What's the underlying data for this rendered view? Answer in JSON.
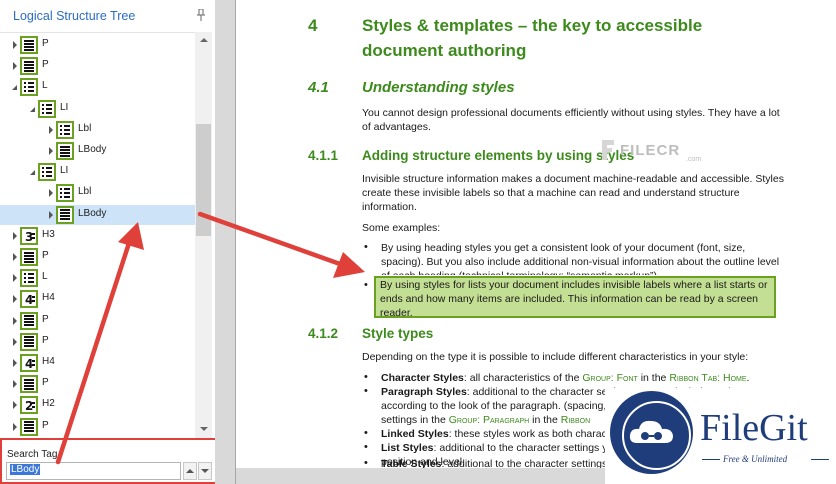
{
  "panel": {
    "title": "Logical Structure Tree",
    "tree": [
      {
        "tag": "P",
        "icon": "paragraph",
        "depth": 0,
        "expander": "collapsed"
      },
      {
        "tag": "P",
        "icon": "paragraph",
        "depth": 0,
        "expander": "collapsed"
      },
      {
        "tag": "L",
        "icon": "list",
        "depth": 0,
        "expander": "expanded"
      },
      {
        "tag": "LI",
        "icon": "list",
        "depth": 1,
        "expander": "expanded"
      },
      {
        "tag": "Lbl",
        "icon": "list",
        "depth": 2,
        "expander": "collapsed"
      },
      {
        "tag": "LBody",
        "icon": "paragraph",
        "depth": 2,
        "expander": "collapsed"
      },
      {
        "tag": "LI",
        "icon": "list",
        "depth": 1,
        "expander": "expanded"
      },
      {
        "tag": "Lbl",
        "icon": "list",
        "depth": 2,
        "expander": "collapsed"
      },
      {
        "tag": "LBody",
        "icon": "paragraph",
        "depth": 2,
        "expander": "collapsed",
        "selected": true
      },
      {
        "tag": "H3",
        "icon": "heading-3",
        "depth": 0,
        "expander": "collapsed"
      },
      {
        "tag": "P",
        "icon": "paragraph",
        "depth": 0,
        "expander": "collapsed"
      },
      {
        "tag": "L",
        "icon": "list",
        "depth": 0,
        "expander": "collapsed"
      },
      {
        "tag": "H4",
        "icon": "heading-4",
        "depth": 0,
        "expander": "collapsed"
      },
      {
        "tag": "P",
        "icon": "paragraph",
        "depth": 0,
        "expander": "collapsed"
      },
      {
        "tag": "P",
        "icon": "paragraph",
        "depth": 0,
        "expander": "collapsed"
      },
      {
        "tag": "H4",
        "icon": "heading-4",
        "depth": 0,
        "expander": "collapsed"
      },
      {
        "tag": "P",
        "icon": "paragraph",
        "depth": 0,
        "expander": "collapsed"
      },
      {
        "tag": "H2",
        "icon": "heading-2",
        "depth": 0,
        "expander": "collapsed"
      },
      {
        "tag": "P",
        "icon": "paragraph",
        "depth": 0,
        "expander": "collapsed"
      }
    ],
    "search": {
      "label": "Search Tag",
      "value": "LBody"
    }
  },
  "document": {
    "h1": {
      "num": "4",
      "line1": "Styles & templates – the key to accessible",
      "line2": "document authoring"
    },
    "h2": {
      "num": "4.1",
      "text": "Understanding styles"
    },
    "p1": {
      "line1": "You cannot design professional documents efficiently without using styles. They have a lot",
      "line2": "of advantages."
    },
    "h3a": {
      "num": "4.1.1",
      "text": "Adding structure elements by using styles"
    },
    "p2": {
      "line1": "Invisible structure information makes a document machine-readable and accessible. Styles",
      "line2": "create these invisible labels so that a machine can read and understand structure",
      "line3": "information."
    },
    "p3": "Some examples:",
    "bullet1": {
      "line1": "By using heading styles you get a consistent look of your document (font, size,",
      "line2": "spacing). But you also include additional non-visual information about the outline level",
      "line3": "of each heading (technical terminology: “semantic markup”)."
    },
    "bullet2": {
      "line1": "By using styles for lists your document includes invisible labels where a list starts or",
      "line2": "ends and how many items are included. This information can be read by a screen",
      "line3": "reader."
    },
    "h3b": {
      "num": "4.1.2",
      "text": "Style types"
    },
    "p4": "Depending on the type it is possible to include different characteristics in your style:",
    "items": {
      "cs_term": "Character Styles",
      "cs_text": ": all characteristics of the ",
      "cs_ref1": "Group: Font",
      "cs_in": " in the ",
      "cs_ref2": "Ribbon Tab: Home",
      "cs_end": ".",
      "ps_term": "Paragraph Styles",
      "ps_text": ": additional to the character settings you can include settings",
      "ps_line2": "according to the look of the paragraph. (spacing,",
      "ps_line3a": "settings in the ",
      "ps_ref1": "Group: Paragraph",
      "ps_line3b": " in the ",
      "ps_ref2": "Ribbon",
      "ls_term": "Linked Styles",
      "ls_text": ": these styles work as both charact",
      "lis_term": "List Styles",
      "lis_text": ": additional to the character settings y",
      "lis_line2": "position and level.",
      "ts_term": "Table Styles",
      "ts_text": ": additional to the character settings"
    }
  },
  "watermarks": {
    "filecr": {
      "name": "FILECR",
      "suffix": ".com"
    },
    "filegit": {
      "name": "FileGit",
      "tagline": "Free & Unlimited"
    }
  },
  "colors": {
    "heading_green": "#3d8a1d",
    "icon_border_green": "#6aa121",
    "highlight_fill": "#c3df94",
    "annotation_red": "#e0403a",
    "panel_title_blue": "#2b6cc4",
    "selection_blue": "#cde3f7",
    "filegit_navy": "#1f3d7a"
  }
}
